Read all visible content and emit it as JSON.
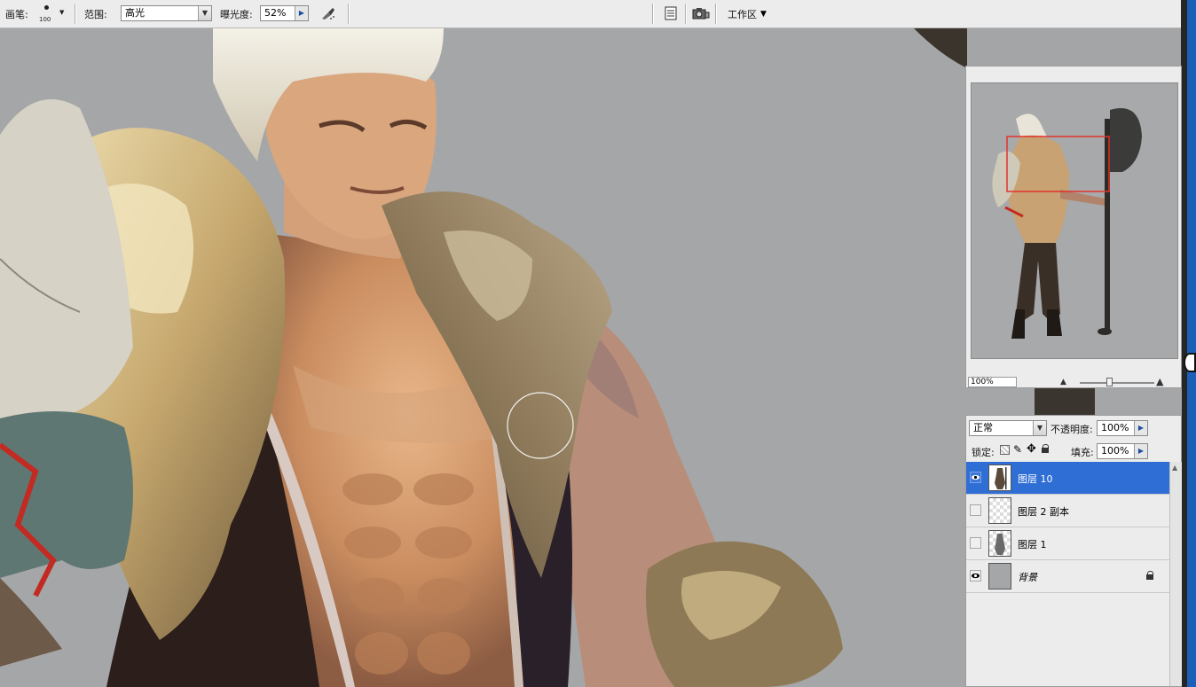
{
  "options_bar": {
    "brush_label": "画笔:",
    "brush_size": "100",
    "range_label": "范围:",
    "range_value": "高光",
    "exposure_label": "曝光度:",
    "exposure_value": "52%",
    "workspace_label": "工作区"
  },
  "navigator": {
    "zoom_value": "100%"
  },
  "layers_panel": {
    "blend_mode": "正常",
    "opacity_label": "不透明度:",
    "opacity_value": "100%",
    "lock_label": "锁定:",
    "fill_label": "填充:",
    "fill_value": "100%",
    "layers": [
      {
        "name": "图层 10",
        "visible": true,
        "selected": true
      },
      {
        "name": "图层 2 副本",
        "visible": false,
        "selected": false
      },
      {
        "name": "图层 1",
        "visible": false,
        "selected": false
      },
      {
        "name": "背景",
        "visible": true,
        "selected": false,
        "locked": true
      }
    ]
  },
  "colors": {
    "selection": "#2f6ed4",
    "canvas_bg": "#a5a6a8",
    "panel_bg": "#ececec"
  }
}
